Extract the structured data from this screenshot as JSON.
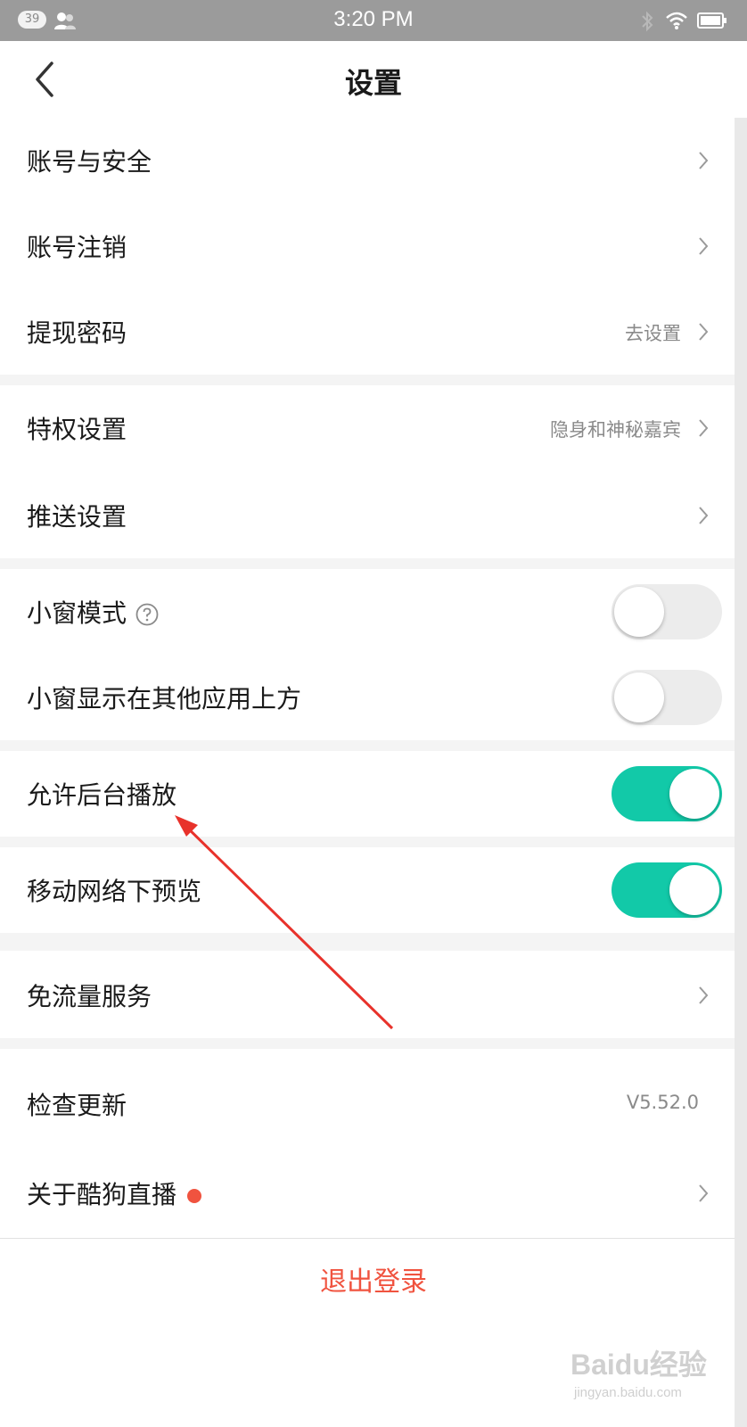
{
  "status_bar": {
    "notification_count": "39",
    "time": "3:20 PM"
  },
  "header": {
    "title": "设置"
  },
  "rows": {
    "account_security": {
      "label": "账号与安全"
    },
    "account_cancel": {
      "label": "账号注销"
    },
    "withdraw_password": {
      "label": "提现密码",
      "value": "去设置"
    },
    "privilege_settings": {
      "label": "特权设置",
      "value": "隐身和神秘嘉宾"
    },
    "push_settings": {
      "label": "推送设置"
    },
    "mini_window_mode": {
      "label": "小窗模式",
      "toggle_on": false
    },
    "mini_window_overlay": {
      "label": "小窗显示在其他应用上方",
      "toggle_on": false
    },
    "background_play": {
      "label": "允许后台播放",
      "toggle_on": true
    },
    "mobile_preview": {
      "label": "移动网络下预览",
      "toggle_on": true
    },
    "free_data_service": {
      "label": "免流量服务"
    },
    "check_update": {
      "label": "检查更新",
      "value": "V5.52.0"
    },
    "about": {
      "label": "关于酷狗直播"
    }
  },
  "logout": {
    "label": "退出登录"
  },
  "colors": {
    "accent_toggle": "#12c9a8",
    "logout_red": "#f0533f",
    "annotation_arrow": "#e8322b"
  },
  "watermark": {
    "logo": "Baidu经验",
    "url": "jingyan.baidu.com"
  }
}
